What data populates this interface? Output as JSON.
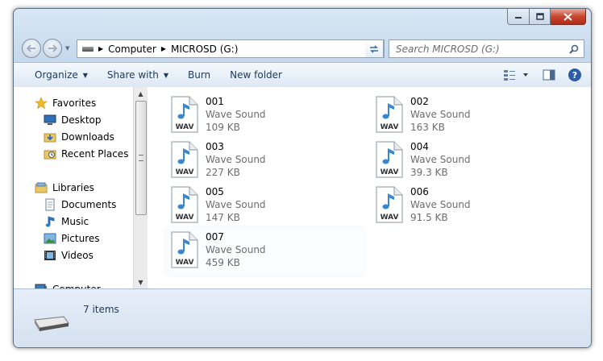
{
  "window": {
    "caption_buttons": [
      "minimize",
      "maximize",
      "close"
    ]
  },
  "address": {
    "root": "Computer",
    "current": "MICROSD (G:)"
  },
  "search": {
    "placeholder": "Search MICROSD (G:)"
  },
  "toolbar": {
    "organize": "Organize",
    "share_with": "Share with",
    "burn": "Burn",
    "new_folder": "New folder"
  },
  "nav": {
    "favorites": "Favorites",
    "desktop": "Desktop",
    "downloads": "Downloads",
    "recent_places": "Recent Places",
    "libraries": "Libraries",
    "documents": "Documents",
    "music": "Music",
    "pictures": "Pictures",
    "videos": "Videos",
    "computer": "Computer"
  },
  "files": [
    {
      "name": "001",
      "type": "Wave Sound",
      "size": "109 KB",
      "icon_label": "WAV"
    },
    {
      "name": "002",
      "type": "Wave Sound",
      "size": "163 KB",
      "icon_label": "WAV"
    },
    {
      "name": "003",
      "type": "Wave Sound",
      "size": "227 KB",
      "icon_label": "WAV"
    },
    {
      "name": "004",
      "type": "Wave Sound",
      "size": "39.3 KB",
      "icon_label": "WAV"
    },
    {
      "name": "005",
      "type": "Wave Sound",
      "size": "147 KB",
      "icon_label": "WAV"
    },
    {
      "name": "006",
      "type": "Wave Sound",
      "size": "91.5 KB",
      "icon_label": "WAV"
    },
    {
      "name": "007",
      "type": "Wave Sound",
      "size": "459 KB",
      "icon_label": "WAV"
    }
  ],
  "status": {
    "count": "7 items"
  },
  "colors": {
    "accent": "#1e395b",
    "close": "#c7452f",
    "frame": "#c7d9ec"
  }
}
